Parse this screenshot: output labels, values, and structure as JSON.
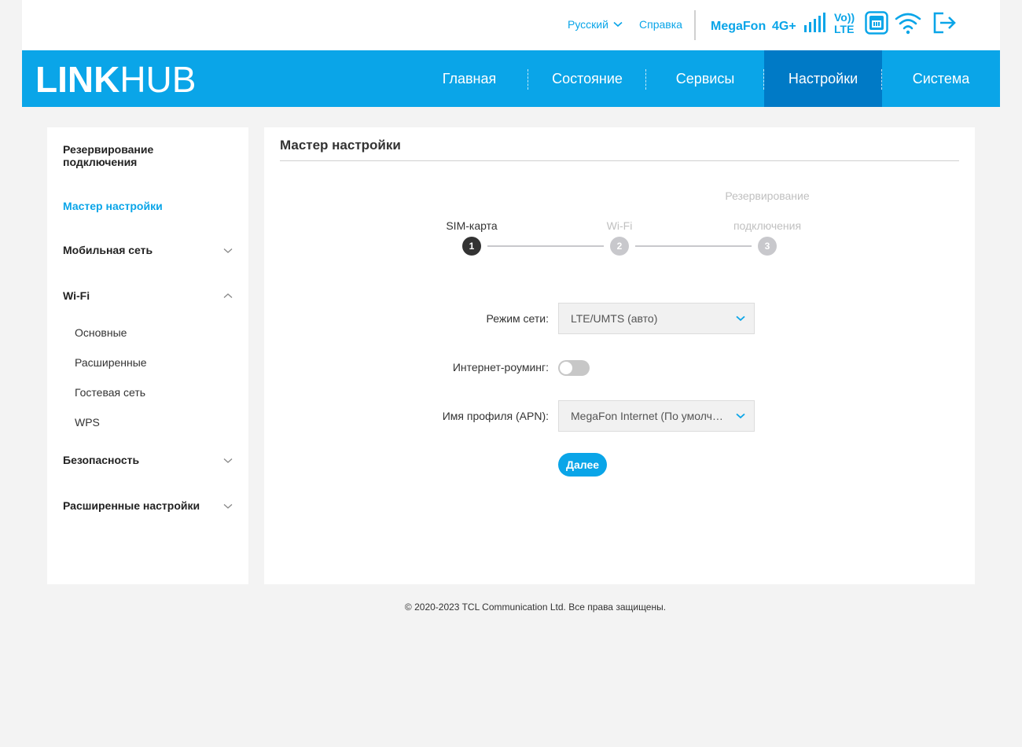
{
  "topbar": {
    "language": "Русский",
    "help": "Справка",
    "operator": "MegaFon",
    "network_type": "4G+",
    "volte_top": "Vo))",
    "volte_bottom": "LTE"
  },
  "header": {
    "logo_bold": "LINK",
    "logo_thin": "HUB",
    "nav": [
      {
        "label": "Главная"
      },
      {
        "label": "Состояние"
      },
      {
        "label": "Сервисы"
      },
      {
        "label": "Настройки",
        "active": true
      },
      {
        "label": "Система"
      }
    ]
  },
  "sidebar": {
    "items": [
      {
        "label": "Резервирование подключения"
      },
      {
        "label": "Мастер настройки",
        "active": true
      },
      {
        "label": "Мобильная сеть",
        "expanded": false
      },
      {
        "label": "Wi-Fi",
        "expanded": true
      },
      {
        "label": "Безопасность",
        "expanded": false
      },
      {
        "label": "Расширенные настройки",
        "expanded": false
      }
    ],
    "wifi_sub": [
      "Основные",
      "Расширенные",
      "Гостевая сеть",
      "WPS"
    ]
  },
  "main": {
    "title": "Мастер настройки",
    "steps": [
      {
        "label": "SIM-карта",
        "number": "1",
        "state": "active"
      },
      {
        "label": "Wi-Fi",
        "number": "2",
        "state": "inactive"
      },
      {
        "label_line1": "Резервирование",
        "label_line2": "подключения",
        "number": "3",
        "state": "inactive"
      }
    ],
    "form": {
      "network_mode_label": "Режим сети:",
      "network_mode_value": "LTE/UMTS (авто)",
      "roaming_label": "Интернет-роуминг:",
      "roaming_enabled": false,
      "apn_label": "Имя профиля (APN):",
      "apn_value": "MegaFon Internet (По умолчанию)",
      "next_button": "Далее"
    }
  },
  "footer": {
    "copyright": "© 2020-2023 TCL Communication Ltd. Все права защищены."
  },
  "colors": {
    "accent": "#0aa5e8",
    "nav_active": "#007ac6",
    "step_active": "#333333",
    "step_inactive": "#c8c8cc",
    "toggle_off": "#c7c7c7"
  }
}
